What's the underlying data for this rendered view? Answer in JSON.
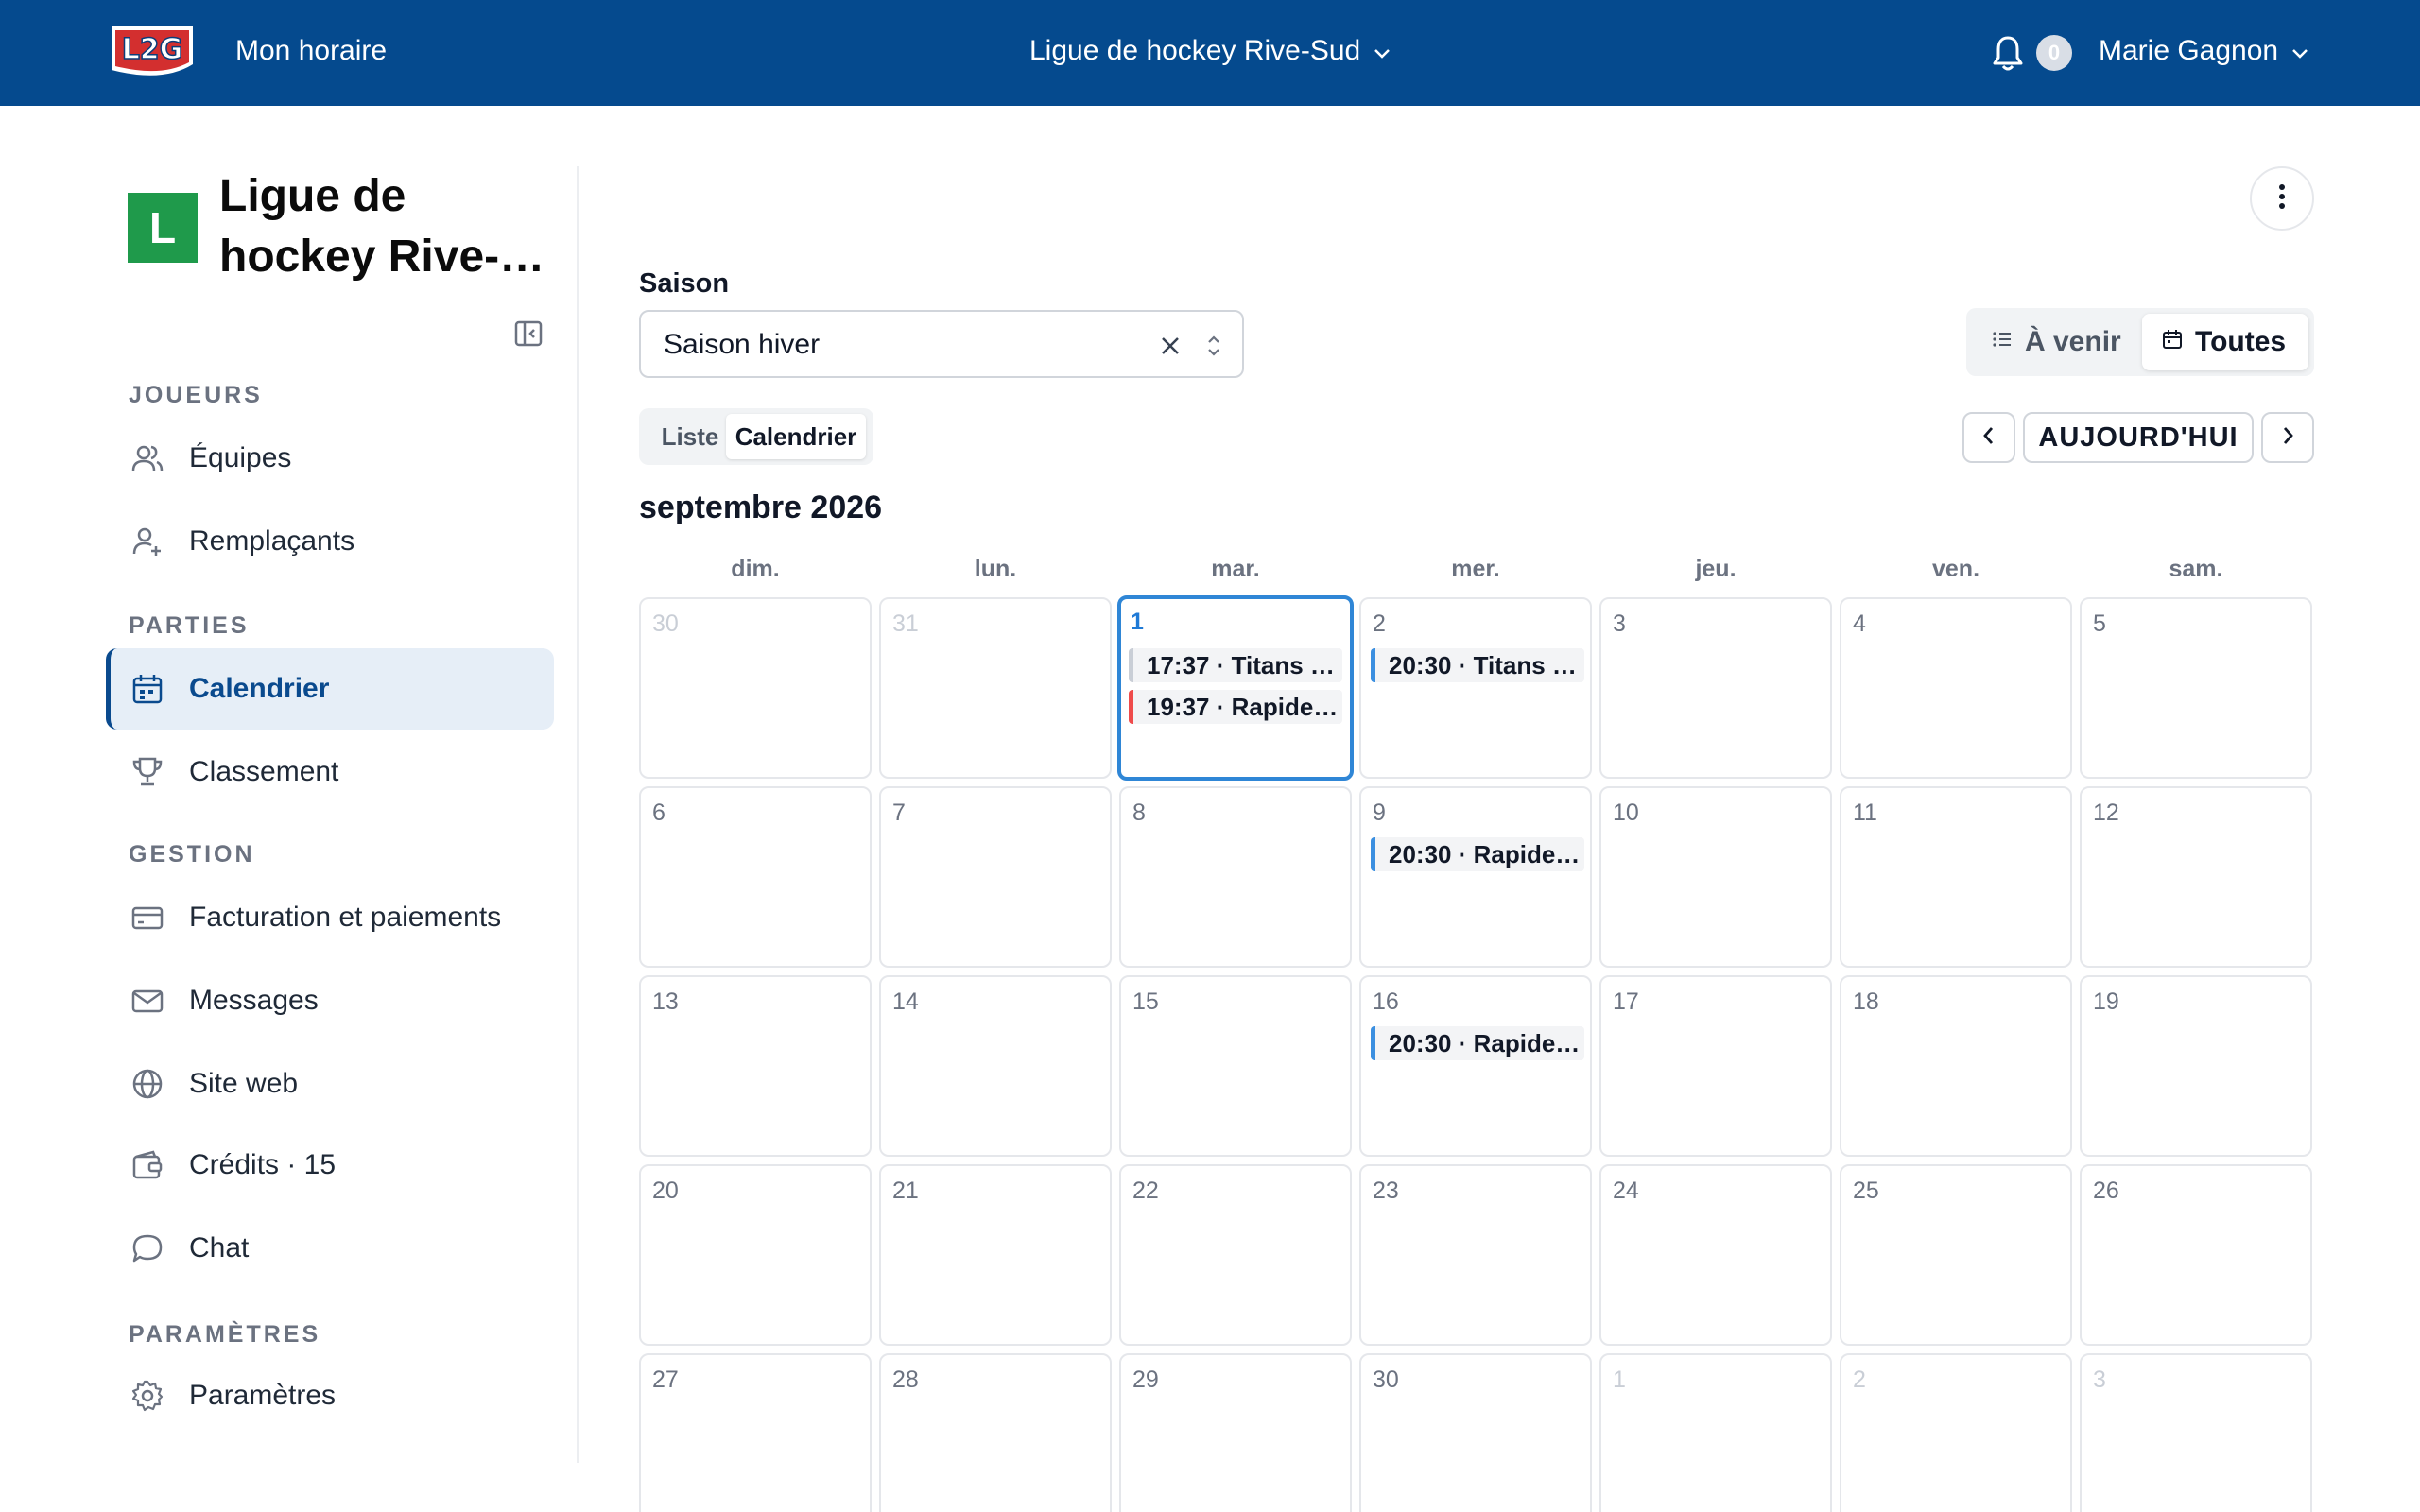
{
  "topbar": {
    "app_title": "Mon horaire",
    "league_name": "Ligue de hockey Rive-Sud",
    "notification_count": "0",
    "user_name": "Marie Gagnon"
  },
  "sidebar": {
    "org_initial": "L",
    "org_name": "Ligue de hockey Rive-…",
    "sections": {
      "players": "JOUEURS",
      "games": "PARTIES",
      "management": "GESTION",
      "settings": "PARAMÈTRES"
    },
    "items": {
      "teams": "Équipes",
      "substitutes": "Remplaçants",
      "calendar": "Calendrier",
      "standings": "Classement",
      "billing": "Facturation et paiements",
      "messages": "Messages",
      "website": "Site web",
      "credits": "Crédits · 15",
      "chat": "Chat",
      "settings": "Paramètres"
    }
  },
  "main": {
    "season_label": "Saison",
    "season_value": "Saison hiver",
    "filters": {
      "upcoming": "À venir",
      "all": "Toutes"
    },
    "views": {
      "list": "Liste",
      "calendar": "Calendrier"
    },
    "today_button": "AUJOURD'HUI",
    "month_title": "septembre 2026",
    "weekdays": [
      "dim.",
      "lun.",
      "mar.",
      "mer.",
      "jeu.",
      "ven.",
      "sam."
    ],
    "weeks": [
      [
        "30",
        "31",
        "1",
        "2",
        "3",
        "4",
        "5"
      ],
      [
        "6",
        "7",
        "8",
        "9",
        "10",
        "11",
        "12"
      ],
      [
        "13",
        "14",
        "15",
        "16",
        "17",
        "18",
        "19"
      ],
      [
        "20",
        "21",
        "22",
        "23",
        "24",
        "25",
        "26"
      ],
      [
        "27",
        "28",
        "29",
        "30",
        "1",
        "2",
        "3"
      ]
    ],
    "events": {
      "sep1_a": "17:37 · Titans …",
      "sep1_b": "19:37 · Rapide…",
      "sep2": "20:30 · Titans …",
      "sep9": "20:30 · Rapide…",
      "sep16": "20:30 · Rapide…"
    },
    "event_colors": {
      "gray": "#c9ced6",
      "red": "#ef4b4b",
      "blue": "#3b8fe0"
    }
  }
}
